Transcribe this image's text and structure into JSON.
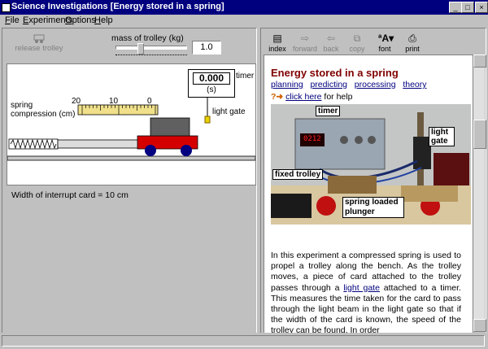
{
  "window": {
    "title": "Science Investigations [Energy stored in a spring]"
  },
  "menu": {
    "items": [
      {
        "label": "File",
        "key": "F",
        "rest": "ile"
      },
      {
        "label": "Experiments",
        "key": "E",
        "rest": "xperiments"
      },
      {
        "label": "Options",
        "key": "O",
        "rest": "ptions"
      },
      {
        "label": "Help",
        "key": "H",
        "rest": "elp"
      }
    ]
  },
  "left": {
    "release_label": "release trolley",
    "mass_label": "mass of trolley (kg)",
    "mass_value": "1.0",
    "mass_fraction": 0.33,
    "timer_value": "0.000",
    "timer_unit": "(s)",
    "timer_label": "timer",
    "light_gate_label": "light gate",
    "spring_label_1": "spring",
    "spring_label_2": "compression (cm)",
    "ruler_ticks": [
      "20",
      "10",
      "0"
    ],
    "interrupt_text": "Width of interrupt card = 10 cm"
  },
  "toolbar": {
    "buttons": [
      {
        "label": "index",
        "icon": "index-icon",
        "enabled": true
      },
      {
        "label": "forward",
        "icon": "forward-icon",
        "enabled": false
      },
      {
        "label": "back",
        "icon": "back-icon",
        "enabled": false
      },
      {
        "label": "copy",
        "icon": "copy-icon",
        "enabled": false
      },
      {
        "label": "font",
        "icon": "font-icon",
        "enabled": true
      },
      {
        "label": "print",
        "icon": "print-icon",
        "enabled": true
      }
    ]
  },
  "doc": {
    "heading": "Energy stored in a spring",
    "links": [
      "planning",
      "predicting",
      "processing",
      "theory"
    ],
    "help_link": "click here",
    "help_rest": "for help",
    "photo_labels": {
      "timer": "timer",
      "light_gate": "light gate",
      "fixed_trolley": "fixed trolley",
      "plunger": "spring loaded plunger",
      "display": "0212"
    },
    "para_1": "In this experiment a compressed spring is used to propel a trolley along the bench. As the trolley moves, a piece of card attached to the trolley passes through a",
    "para_link": "light gate",
    "para_2": "attached to a timer. This measures the time taken for the card to pass through the light beam in the light gate so that if the width of the card is known, the speed of the trolley can be found. In order"
  },
  "colors": {
    "title_bg": "#00007f",
    "heading": "#800000",
    "link": "#00007f",
    "trolley": "#d40000",
    "wheel": "#000080"
  }
}
